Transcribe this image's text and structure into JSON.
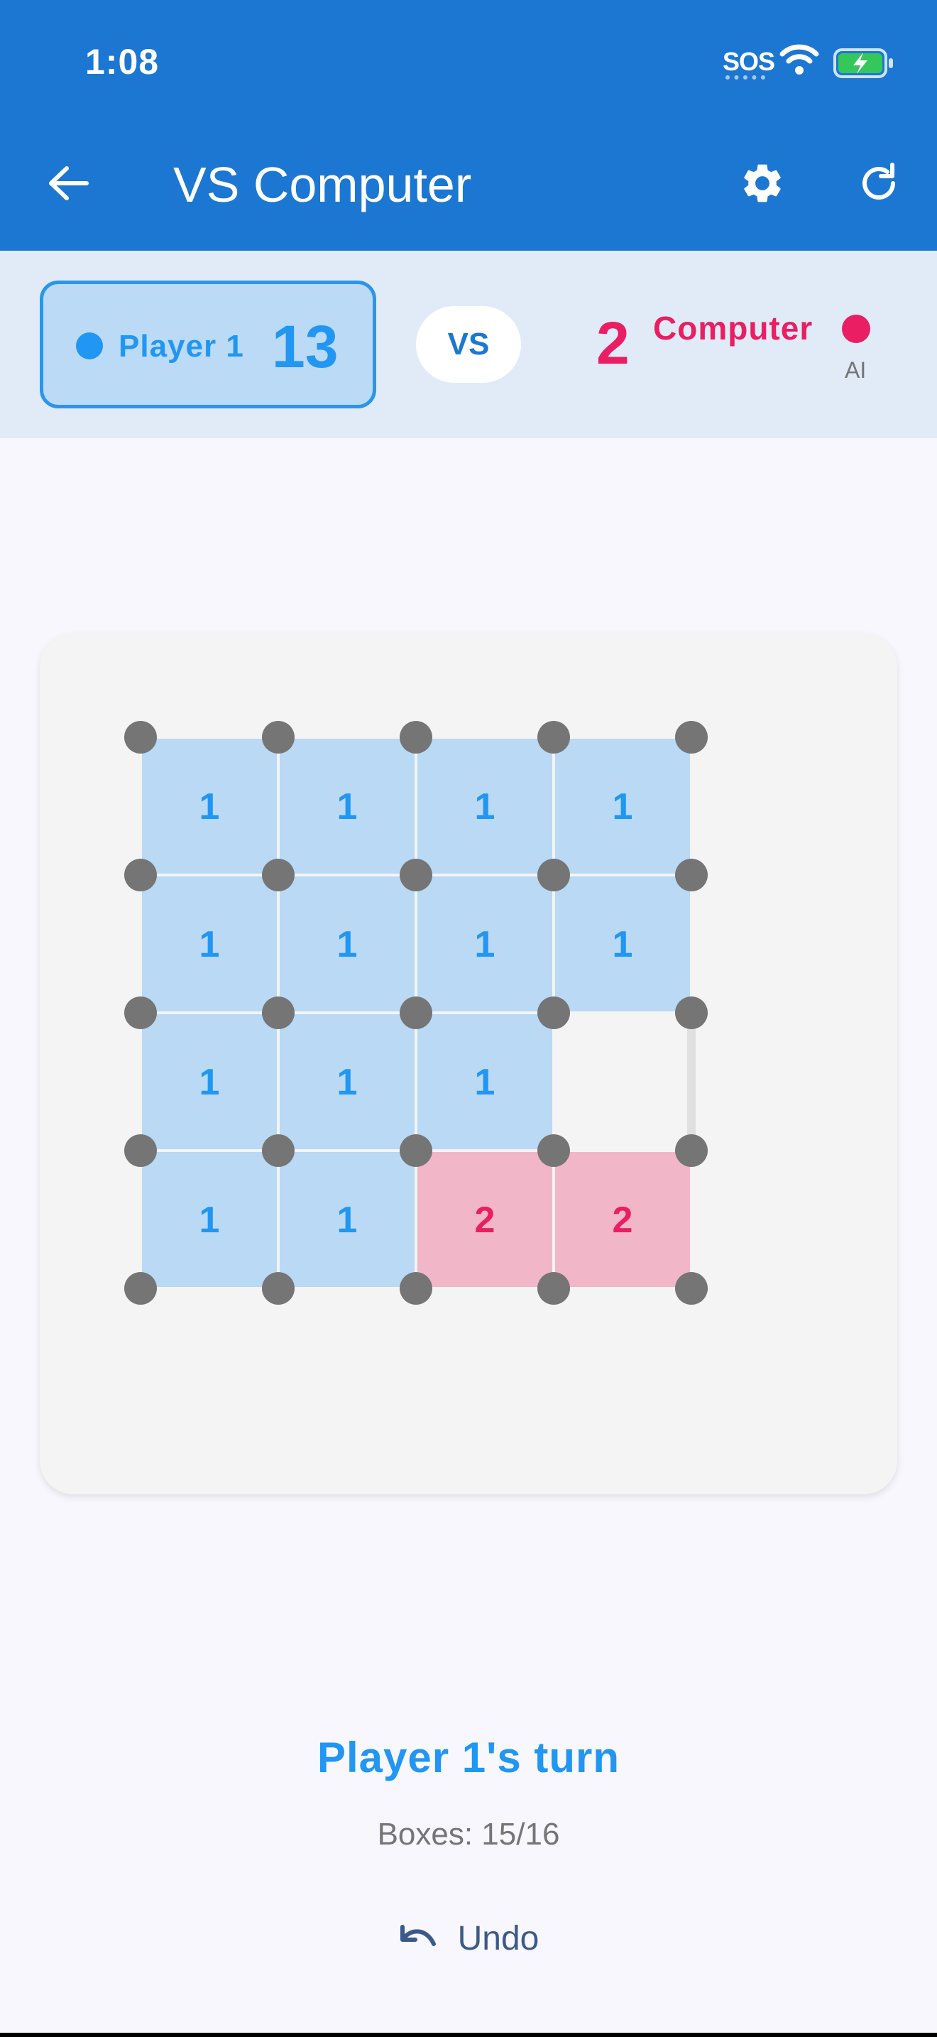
{
  "status_bar": {
    "time": "1:08",
    "sos": "SOS",
    "icons": [
      "wifi-icon",
      "battery-charging-icon"
    ]
  },
  "app_bar": {
    "title": "VS Computer",
    "back_icon": "arrow-back-icon",
    "settings_icon": "gear-icon",
    "refresh_icon": "refresh-icon"
  },
  "scores": {
    "player1": {
      "name": "Player 1",
      "score": "13",
      "color": "#2196f3"
    },
    "vs": "VS",
    "computer": {
      "name": "Computer",
      "score": "2",
      "subtitle": "AI",
      "color": "#e91e63"
    }
  },
  "board": {
    "size": 4,
    "colors": {
      "p1": "#2196f3",
      "p2": "#e91e63",
      "empty": "#e0e0e0",
      "dot": "#757575",
      "p1_fill": "#b9d9f4",
      "p2_fill": "#f2b6c9"
    },
    "boxes": [
      [
        "1",
        "1",
        "1",
        "1"
      ],
      [
        "1",
        "1",
        "1",
        "1"
      ],
      [
        "1",
        "1",
        "1",
        ""
      ],
      [
        "1",
        "1",
        "2",
        "2"
      ]
    ],
    "h_edges": [
      [
        "p1",
        "p2",
        "p2",
        "p2"
      ],
      [
        "p1",
        "p1",
        "p1",
        "p1"
      ],
      [
        "p1",
        "p2",
        "p2",
        "p1"
      ],
      [
        "p1",
        "p1",
        "p2",
        "p2"
      ],
      [
        "p1",
        "p2",
        "p2",
        "p1"
      ]
    ],
    "v_edges": [
      [
        "p1",
        "p1",
        "p1",
        "p2",
        "p2"
      ],
      [
        "p1",
        "p2",
        "p1",
        "p1",
        "p1"
      ],
      [
        "p1",
        "p1",
        "p1",
        "p1",
        "empty"
      ],
      [
        "p2",
        "p1",
        "p2",
        "p2",
        "p1"
      ]
    ]
  },
  "status": {
    "turn": "Player 1's turn",
    "boxes": "Boxes: 15/16"
  },
  "actions": {
    "undo_label": "Undo",
    "undo_icon": "undo-icon"
  }
}
